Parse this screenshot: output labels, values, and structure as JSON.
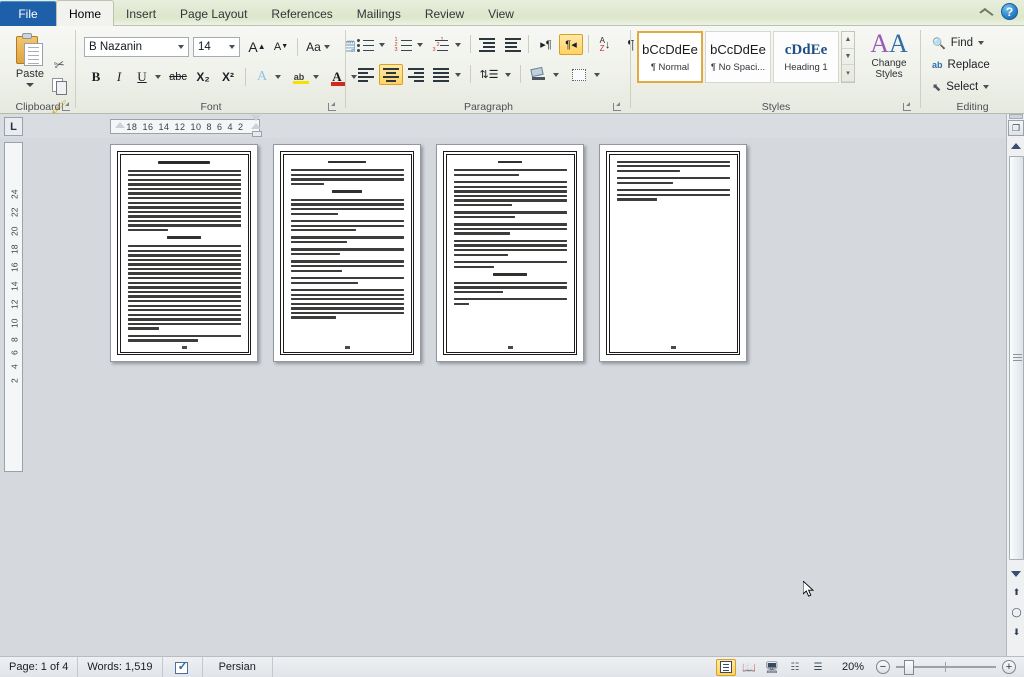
{
  "window": {
    "app": "Microsoft Word",
    "minimize_ribbon_icon": "chevron-up-icon",
    "help_label": "?"
  },
  "ribbon": {
    "file_tab": "File",
    "tabs": [
      {
        "label": "Home",
        "active": true
      },
      {
        "label": "Insert",
        "active": false
      },
      {
        "label": "Page Layout",
        "active": false
      },
      {
        "label": "References",
        "active": false
      },
      {
        "label": "Mailings",
        "active": false
      },
      {
        "label": "Review",
        "active": false
      },
      {
        "label": "View",
        "active": false
      }
    ],
    "groups": {
      "clipboard": {
        "label": "Clipboard",
        "paste": "Paste",
        "cut_icon": "scissors-icon",
        "copy_icon": "copy-icon",
        "format_painter_icon": "format-painter-icon"
      },
      "font": {
        "label": "Font",
        "font_name": "B Nazanin",
        "font_size": "14",
        "grow_font": "A",
        "shrink_font": "A",
        "change_case": "Aa",
        "clear_formatting_icon": "clear-formatting-icon",
        "bold": "B",
        "italic": "I",
        "underline": "U",
        "strikethrough": "abc",
        "subscript": "X₂",
        "superscript": "X²",
        "text_effects": "A",
        "highlight": "ab",
        "font_color": "A"
      },
      "paragraph": {
        "label": "Paragraph",
        "bullets_icon": "bullets-icon",
        "numbering_icon": "numbering-icon",
        "multilevel_icon": "multilevel-list-icon",
        "decrease_indent_icon": "decrease-indent-icon",
        "increase_indent_icon": "increase-indent-icon",
        "ltr_icon": "left-to-right-icon",
        "rtl_icon": "right-to-left-icon",
        "rtl_active": true,
        "sort_icon": "sort-az-icon",
        "show_marks_icon": "pilcrow-icon",
        "align_left_icon": "align-left-icon",
        "align_center_icon": "align-center-icon",
        "align_center_active": true,
        "align_right_icon": "align-right-icon",
        "justify_icon": "justify-icon",
        "line_spacing_icon": "line-spacing-icon",
        "shading_icon": "shading-icon",
        "borders_icon": "borders-icon"
      },
      "styles": {
        "label": "Styles",
        "items": [
          {
            "preview": "bCcDdEe",
            "name": "¶ Normal",
            "selected": true,
            "kind": "normal"
          },
          {
            "preview": "bCcDdEe",
            "name": "¶ No Spaci...",
            "selected": false,
            "kind": "normal"
          },
          {
            "preview": "cDdEe",
            "name": "Heading 1",
            "selected": false,
            "kind": "heading"
          }
        ],
        "change_styles": "Change",
        "change_styles_2": "Styles"
      },
      "editing": {
        "label": "Editing",
        "find": "Find",
        "replace": "Replace",
        "select": "Select",
        "find_icon": "binoculars-icon",
        "replace_icon": "replace-icon",
        "select_icon": "select-arrow-icon"
      }
    }
  },
  "rulers": {
    "tab_selector": "L",
    "horizontal_ticks": [
      "18",
      "16",
      "14",
      "12",
      "10",
      "8",
      "6",
      "4",
      "2"
    ],
    "vertical_ticks": [
      "2",
      "4",
      "6",
      "8",
      "10",
      "12",
      "14",
      "16",
      "18",
      "20",
      "22",
      "24"
    ]
  },
  "document": {
    "language_direction": "rtl",
    "pages": [
      {
        "number": "1",
        "has_border": true,
        "has_title": true,
        "title_width_pct": 46,
        "paragraphs": [
          {
            "lines": 14,
            "last_pct": 36
          },
          {
            "heading": true,
            "width_pct": 30
          },
          {
            "lines": 19,
            "last_pct": 28
          },
          {
            "lines": 2,
            "last_pct": 62
          }
        ]
      },
      {
        "number": "2",
        "has_border": true,
        "has_title": false,
        "paragraphs": [
          {
            "heading": true,
            "width_pct": 34
          },
          {
            "lines": 4,
            "last_pct": 30
          },
          {
            "heading": true,
            "width_pct": 26
          },
          {
            "lines": 4,
            "last_pct": 42
          },
          {
            "lines": 3,
            "last_pct": 58
          },
          {
            "lines": 2,
            "last_pct": 50
          },
          {
            "lines": 2,
            "last_pct": 44
          },
          {
            "lines": 3,
            "last_pct": 46
          },
          {
            "lines": 2,
            "last_pct": 60
          },
          {
            "lines": 7,
            "last_pct": 40
          }
        ]
      },
      {
        "number": "3",
        "has_border": true,
        "has_title": false,
        "paragraphs": [
          {
            "heading": true,
            "width_pct": 22
          },
          {
            "lines": 2,
            "last_pct": 58
          },
          {
            "lines": 6,
            "last_pct": 52
          },
          {
            "lines": 2,
            "last_pct": 54
          },
          {
            "lines": 3,
            "last_pct": 50
          },
          {
            "lines": 4,
            "last_pct": 48
          },
          {
            "lines": 2,
            "last_pct": 36
          },
          {
            "heading": true,
            "width_pct": 30
          },
          {
            "lines": 3,
            "last_pct": 44
          },
          {
            "lines": 2,
            "last_pct": 14
          }
        ]
      },
      {
        "number": "4",
        "has_border": true,
        "has_title": false,
        "paragraphs": [
          {
            "lines": 3,
            "last_pct": 56
          },
          {
            "lines": 2,
            "last_pct": 50
          },
          {
            "lines": 3,
            "last_pct": 36
          }
        ]
      }
    ]
  },
  "scrollbar": {
    "split_icon": "split-window-icon",
    "select_object_icon": "select-browse-object-icon",
    "previous_icon": "previous-page-icon",
    "browse_icon": "browse-object-icon",
    "next_icon": "next-page-icon"
  },
  "status_bar": {
    "page": "Page: 1 of 4",
    "words": "Words: 1,519",
    "proofing_icon": "proofing-errors-icon",
    "language": "Persian",
    "views": [
      {
        "name": "print-layout",
        "icon": "print-layout-icon",
        "active": true
      },
      {
        "name": "full-screen-reading",
        "icon": "full-screen-reading-icon",
        "active": false
      },
      {
        "name": "web-layout",
        "icon": "web-layout-icon",
        "active": false
      },
      {
        "name": "outline",
        "icon": "outline-icon",
        "active": false
      },
      {
        "name": "draft",
        "icon": "draft-icon",
        "active": false
      }
    ],
    "zoom": "20%",
    "zoom_out": "−",
    "zoom_in": "+"
  },
  "colors": {
    "accent_highlight": "#ffd263",
    "file_tab": "#1e5fa9",
    "heading_style": "#1f5083",
    "workspace": "#d5d9de"
  }
}
